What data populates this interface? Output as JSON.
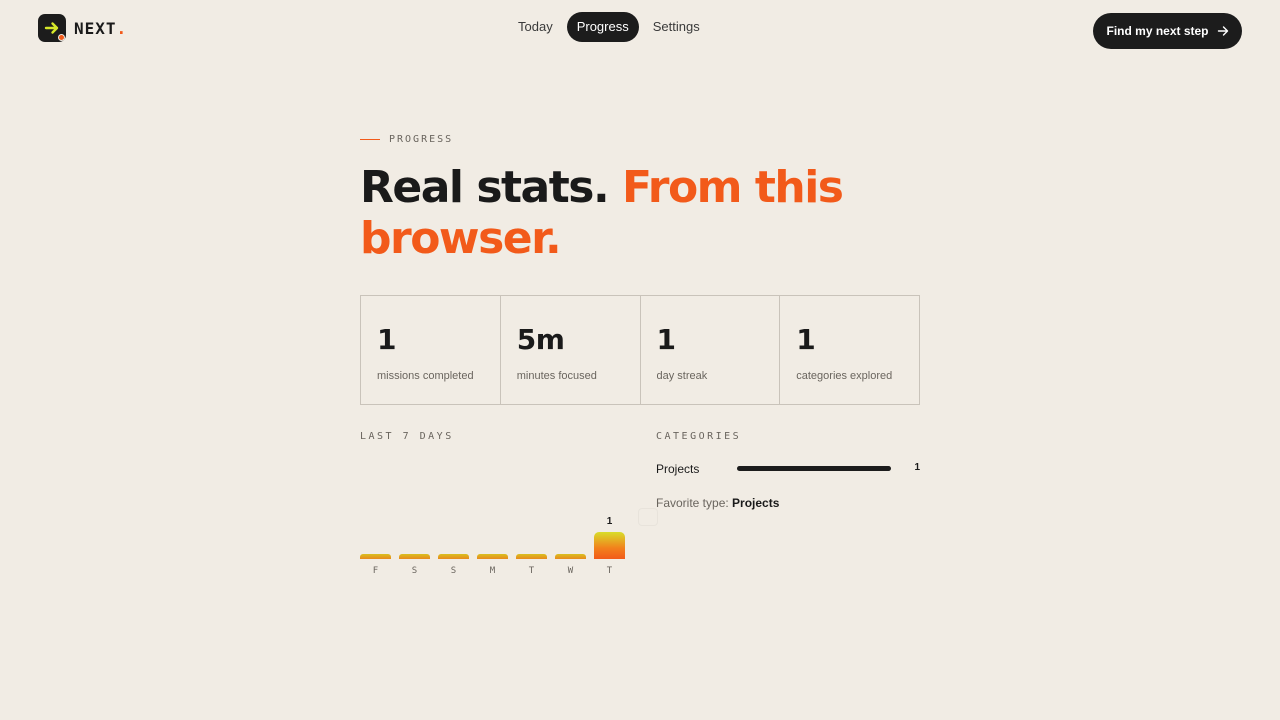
{
  "brand": {
    "name": "NEXT",
    "dot": ".",
    "accent": "#f25a1a"
  },
  "nav": {
    "items": [
      "Today",
      "Progress",
      "Settings"
    ],
    "active": "Progress"
  },
  "cta": {
    "label": "Find my next step",
    "icon": "arrow-right-icon"
  },
  "eyebrow": "PROGRESS",
  "headline": {
    "dark": "Real stats.",
    "orange": "From this browser."
  },
  "stats": [
    {
      "value": "1",
      "label": "missions completed"
    },
    {
      "value": "5m",
      "label": "minutes focused"
    },
    {
      "value": "1",
      "label": "day streak"
    },
    {
      "value": "1",
      "label": "categories explored"
    }
  ],
  "last7": {
    "title": "LAST 7 DAYS",
    "chart_data": {
      "type": "bar",
      "categories": [
        "F",
        "S",
        "S",
        "M",
        "T",
        "W",
        "T"
      ],
      "values": [
        0,
        0,
        0,
        0,
        0,
        0,
        1
      ],
      "data_labels": [
        "",
        "",
        "",
        "",
        "",
        "",
        "1"
      ]
    }
  },
  "categories": {
    "title": "CATEGORIES",
    "items": [
      {
        "name": "Projects",
        "count": "1",
        "fraction": 1.0
      }
    ],
    "favorite_label": "Favorite type:",
    "favorite_value": "Projects"
  }
}
